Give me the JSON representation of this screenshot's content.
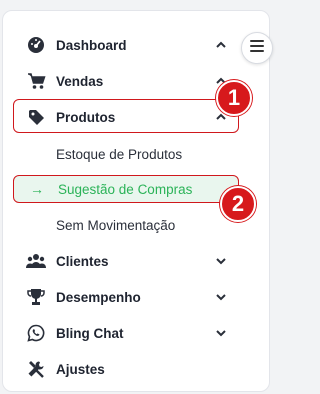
{
  "sidebar": {
    "items": [
      {
        "label": "Dashboard",
        "icon": "dashboard-icon"
      },
      {
        "label": "Vendas",
        "icon": "cart-icon"
      },
      {
        "label": "Produtos",
        "icon": "tag-icon"
      },
      {
        "label": "Clientes",
        "icon": "users-icon"
      },
      {
        "label": "Desempenho",
        "icon": "trophy-icon"
      },
      {
        "label": "Bling Chat",
        "icon": "whatsapp-icon"
      },
      {
        "label": "Ajustes",
        "icon": "tools-icon"
      }
    ],
    "submenu": [
      {
        "label": "Estoque de Produtos"
      },
      {
        "label": "Sugestão de Compras"
      },
      {
        "label": "Sem Movimentação"
      }
    ]
  },
  "annotations": {
    "badge_1": "1",
    "badge_2": "2"
  },
  "colors": {
    "accent_green": "#2bb358",
    "badge_red": "#d7191c",
    "text": "#1f2430"
  }
}
